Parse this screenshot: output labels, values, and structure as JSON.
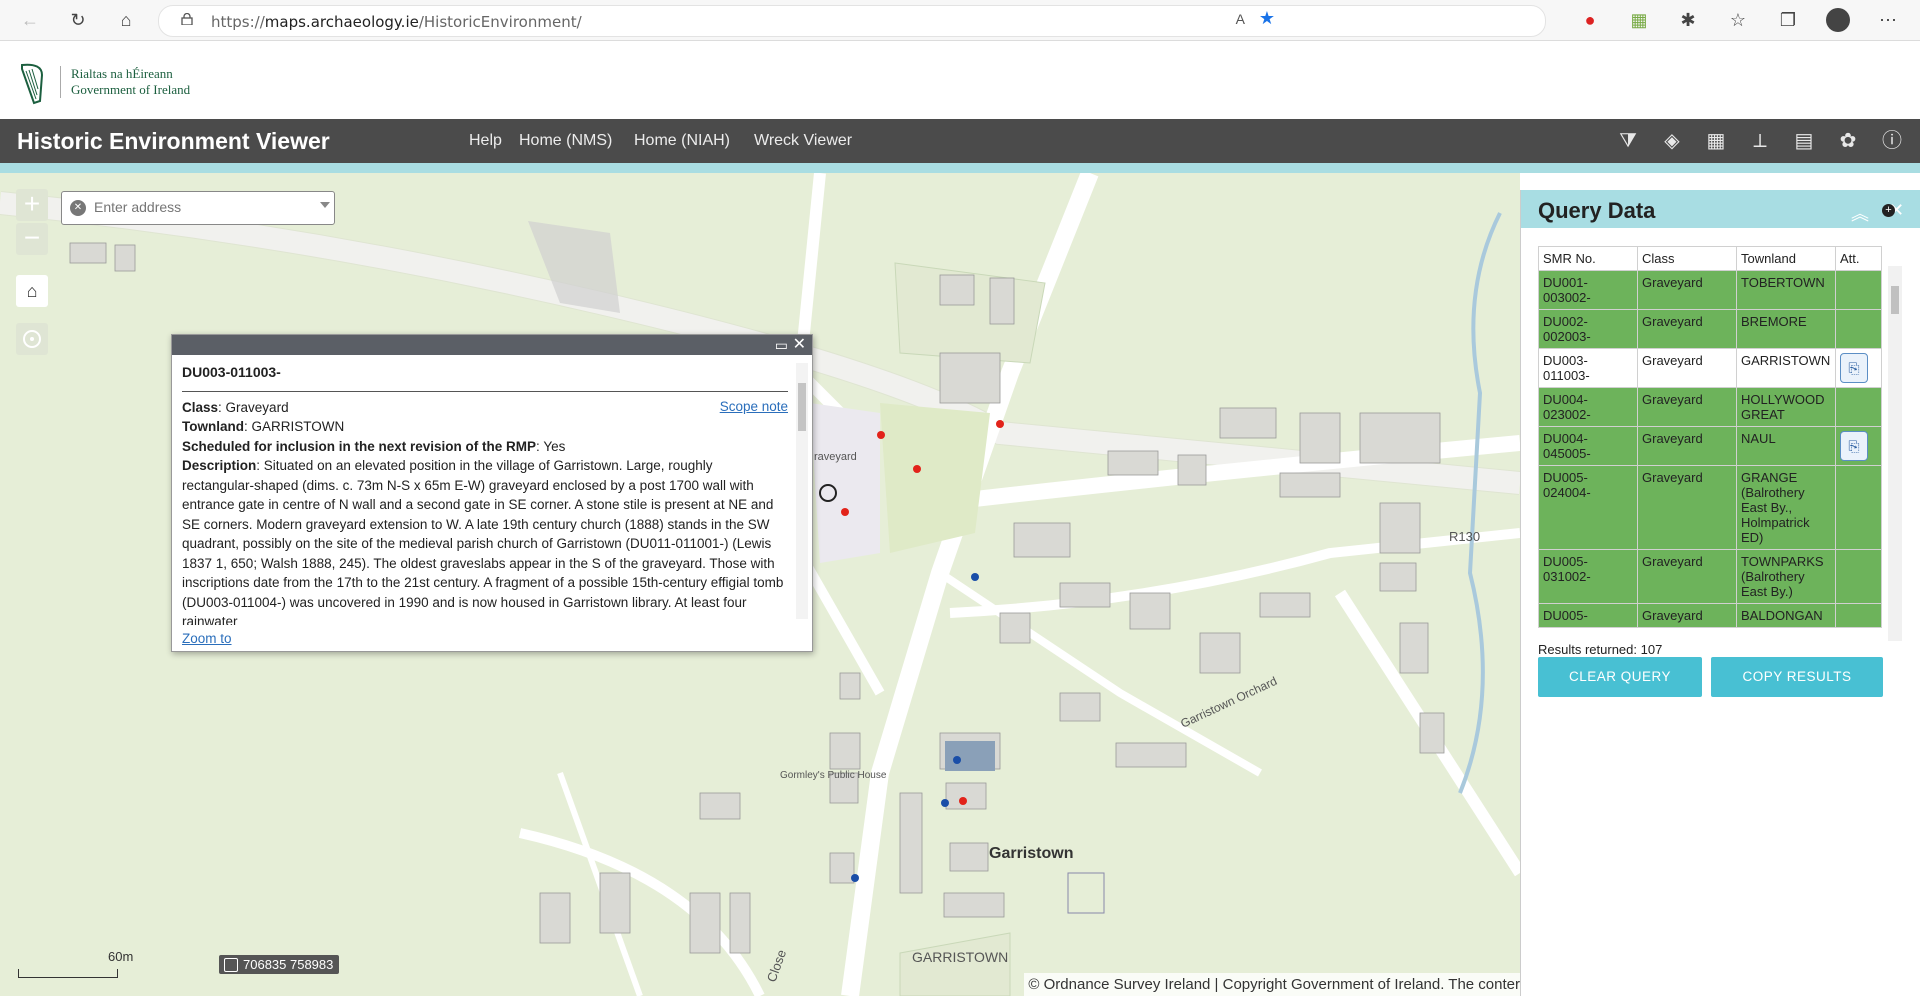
{
  "browser": {
    "url_prefix": "https://",
    "url_host": "maps.archaeology.ie",
    "url_path": "/HistoricEnvironment/"
  },
  "gov": {
    "line1": "Rialtas na hÉireann",
    "line2": "Government of Ireland"
  },
  "app": {
    "title": "Historic Environment Viewer",
    "nav": [
      "Help",
      "Home (NMS)",
      "Home (NIAH)",
      "Wreck Viewer"
    ],
    "tools": [
      "filter-icon",
      "layers-icon",
      "grid-icon",
      "measure-icon",
      "legend-icon",
      "basemap-icon",
      "info-icon"
    ]
  },
  "map": {
    "search_placeholder": "Enter address",
    "scale_label": "60m",
    "coordinates": "706835 758983",
    "attribution": "© Ordnance Survey Ireland | Copyright Government of Ireland. The conter",
    "labels": {
      "town": "Garristown",
      "townland": "GARRISTOWN",
      "road": "R130",
      "orchard": "Garristown Orchard",
      "pub": "Gormley's Public House",
      "graveyard": "raveyard",
      "close": "Close"
    }
  },
  "popup": {
    "heading": "DU003-011003-",
    "scope_note": "Scope note",
    "class_label": "Class",
    "class_value": "Graveyard",
    "townland_label": "Townland",
    "townland_value": "GARRISTOWN",
    "scheduled_label": "Scheduled for inclusion in the next revision of the RMP",
    "scheduled_value": "Yes",
    "description_label": "Description",
    "description": "Situated on an elevated position in the village of Garristown. Large, roughly rectangular-shaped (dims. c. 73m N-S x 65m E-W) graveyard enclosed by a post 1700 wall with entrance gate in centre of N wall and a second gate in SE corner. A stone stile is present at NE and SE corners. Modern graveyard extension to W. A late 19th century church (1888) stands in the SW quadrant, possibly on the site of the medieval parish church of Garristown (DU011-011001-) (Lewis 1837 1, 650; Walsh 1888, 245). The oldest graveslabs appear in the S of the graveyard. Those with inscriptions date from the 17th to the 21st century. A fragment of a possible 15th-century effigial tomb (DU003-011004-) was uncovered in 1990 and is now housed in Garristown library. At least four rainwater",
    "zoom_to": "Zoom to"
  },
  "query": {
    "title": "Query Data",
    "columns": [
      "SMR No.",
      "Class",
      "Townland",
      "Att."
    ],
    "rows": [
      {
        "smr": "DU001-003002-",
        "class": "Graveyard",
        "townland": "TOBERTOWN",
        "att": false,
        "selected": false
      },
      {
        "smr": "DU002-002003-",
        "class": "Graveyard",
        "townland": "BREMORE",
        "att": false,
        "selected": false
      },
      {
        "smr": "DU003-011003-",
        "class": "Graveyard",
        "townland": "GARRISTOWN",
        "att": true,
        "selected": true
      },
      {
        "smr": "DU004-023002-",
        "class": "Graveyard",
        "townland": "HOLLYWOOD GREAT",
        "att": false,
        "selected": false
      },
      {
        "smr": "DU004-045005-",
        "class": "Graveyard",
        "townland": "NAUL",
        "att": true,
        "selected": false
      },
      {
        "smr": "DU005-024004-",
        "class": "Graveyard",
        "townland": "GRANGE (Balrothery East By., Holmpatrick ED)",
        "att": false,
        "selected": false
      },
      {
        "smr": "DU005-031002-",
        "class": "Graveyard",
        "townland": "TOWNPARKS (Balrothery East By.)",
        "att": false,
        "selected": false
      },
      {
        "smr": "DU005-",
        "class": "Graveyard",
        "townland": "BALDONGAN",
        "att": false,
        "selected": false
      }
    ],
    "results_label": "Results returned: 107",
    "clear_button": "CLEAR QUERY",
    "copy_button": "COPY RESULTS"
  }
}
